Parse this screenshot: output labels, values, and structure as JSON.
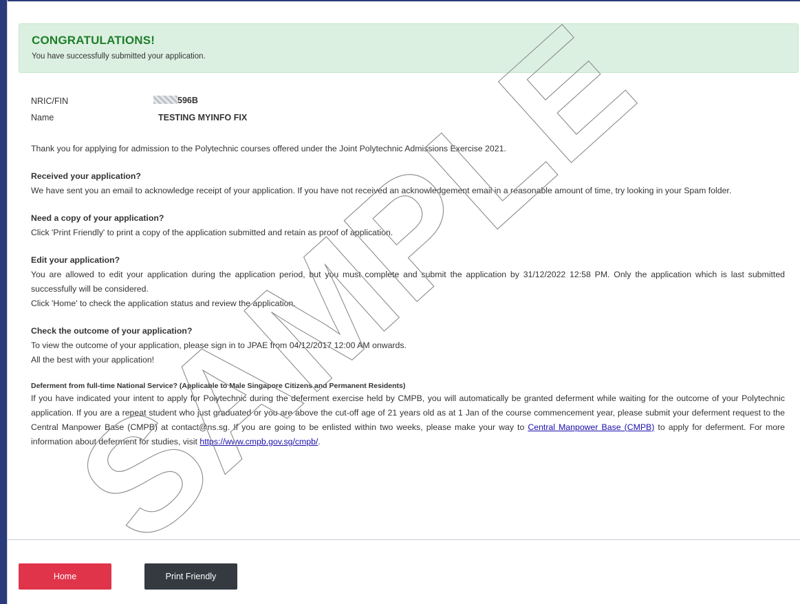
{
  "banner": {
    "title": "CONGRATULATIONS!",
    "subtitle": "You have successfully submitted your application."
  },
  "applicant": {
    "nric_label": "NRIC/FIN",
    "nric_value": "596B",
    "name_label": "Name",
    "name_value": "TESTING MYINFO FIX"
  },
  "intro": "Thank you for applying for admission to the Polytechnic courses offered under the Joint Polytechnic Admissions Exercise 2021.",
  "sections": {
    "received": {
      "heading": "Received your application?",
      "text": "We have sent you an email to acknowledge receipt of your application. If you have not received an acknowledgement email in a reasonable amount of time, try looking in your Spam folder."
    },
    "copy": {
      "heading": "Need a copy of your application?",
      "text": "Click 'Print Friendly' to print a copy of the application submitted and retain as proof of application."
    },
    "edit": {
      "heading": "Edit your application?",
      "text1": "You are allowed to edit your application during the application period, but you must complete and submit the application by 31/12/2022 12:58 PM.  Only the application which is last submitted successfully will be considered.",
      "text2": "Click 'Home' to check the application status and review the application."
    },
    "outcome": {
      "heading": "Check the outcome of your application?",
      "text1": "To view the outcome of your application, please sign in to JPAE from 04/12/2017 12:00 AM onwards.",
      "text2": "All the best with your application!"
    },
    "deferment": {
      "heading": "Deferment from full-time National Service? (Applicable to Male Singapore Citizens and Permanent Residents)",
      "text_a": "If you have indicated your intent to apply for Polytechnic during the deferment exercise held by CMPB, you will automatically be granted deferment while waiting for the outcome of your Polytechnic application. If you are a repeat student who just graduated or you are above the cut-off age of 21 years old as at 1 Jan of the course commencement year, please submit your deferment request to the Central Manpower Base (CMPB) at contact@ns.sg. If you are going to be enlisted within two weeks, please make your way to ",
      "link_cmpb": "Central Manpower Base (CMPB)",
      "text_b": " to apply for deferment. For more information about deferment for studies, visit ",
      "link_url": "https://www.cmpb.gov.sg/cmpb/",
      "text_c": "."
    }
  },
  "watermark": "SAMPLE",
  "buttons": {
    "home": "Home",
    "print": "Print Friendly"
  },
  "colors": {
    "success_bg": "#dcf0e1",
    "success_title": "#1e7e2a",
    "home_button": "#e0344a",
    "print_button": "#343a40"
  }
}
